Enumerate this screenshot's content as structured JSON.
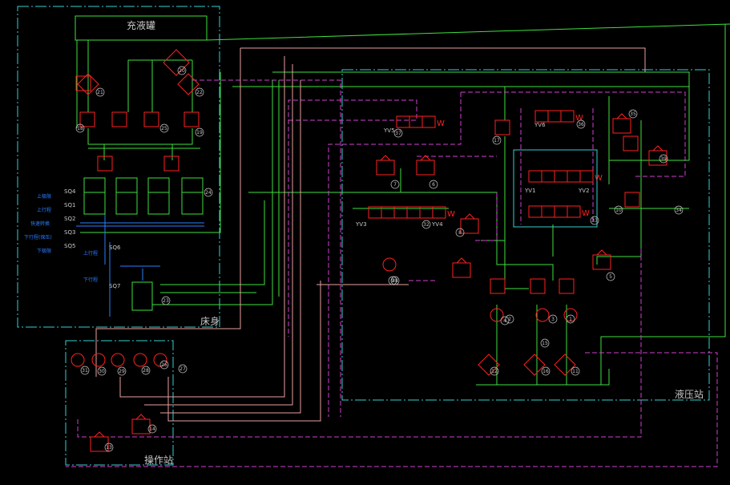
{
  "titles": {
    "tank": "充液罐",
    "bed": "床身",
    "station": "液压站",
    "operator": "操作站"
  },
  "switches": [
    "SQ4",
    "SQ1",
    "SQ2",
    "SQ3",
    "SQ5",
    "SQ6",
    "SQ7"
  ],
  "switch_labels": [
    "上极限",
    "上行程",
    "快速转换",
    "下行程(保压)",
    "下极限",
    "上行程",
    "下行程"
  ],
  "valves": [
    "YV1",
    "YV2",
    "YV3",
    "YV4",
    "YV5",
    "YV6"
  ],
  "component_numbers": [
    "1",
    "2",
    "3",
    "4",
    "5",
    "6",
    "7",
    "8",
    "9",
    "10",
    "11",
    "12",
    "13",
    "14",
    "15",
    "16",
    "17",
    "18",
    "19",
    "20",
    "21",
    "22",
    "23",
    "24",
    "25",
    "26",
    "27",
    "28",
    "29",
    "30",
    "31",
    "32",
    "33",
    "34",
    "35",
    "36",
    "37",
    "38",
    "39"
  ],
  "colors": {
    "background": "#000000",
    "boundary": "#35d0d0",
    "pressure_line": "#3ee03e",
    "pilot_line": "#d040d0",
    "return_line": "#e8a0a0",
    "component": "#ff2020",
    "sensor": "#2a7fff"
  }
}
